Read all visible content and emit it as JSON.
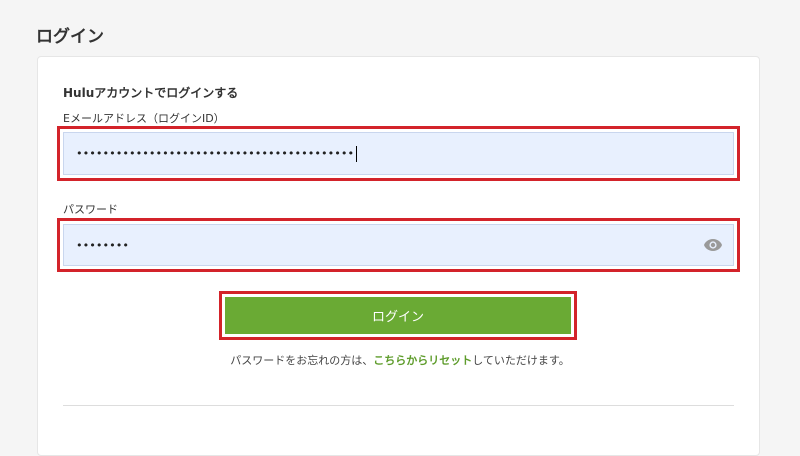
{
  "page": {
    "title": "ログイン"
  },
  "form": {
    "heading": "Huluアカウントでログインする",
    "email": {
      "label": "Eメールアドレス（ログインID）",
      "value": "••••••••••••••••••••••••••••••••••••••••••"
    },
    "password": {
      "label": "パスワード",
      "value": "••••••••",
      "toggle_icon": "eye-icon"
    },
    "submit_label": "ログイン",
    "reset": {
      "prefix": "パスワードをお忘れの方は、",
      "link_text": "こちらからリセット",
      "suffix": "していただけます。"
    }
  },
  "colors": {
    "highlight": "#d3232a",
    "button": "#6aaa34",
    "link": "#5e9c2b",
    "input_bg": "#e8f0fe"
  }
}
